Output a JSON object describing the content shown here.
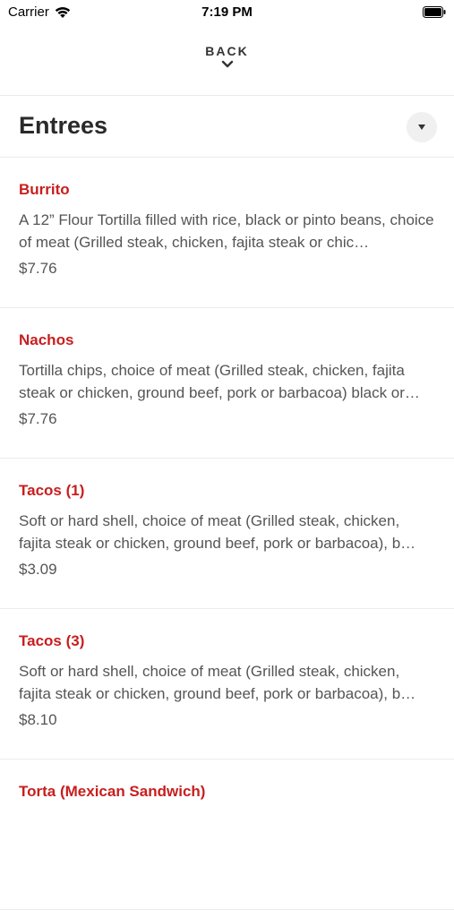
{
  "status_bar": {
    "carrier": "Carrier",
    "time": "7:19 PM"
  },
  "nav": {
    "back_label": "BACK"
  },
  "section": {
    "title": "Entrees"
  },
  "colors": {
    "item_name": "#c81e1e",
    "text_secondary": "#555555",
    "dropdown_bg": "#f0f0f0"
  },
  "menu_items": [
    {
      "name": "Burrito",
      "description": "A 12” Flour Tortilla filled with rice, black or pinto beans, choice of meat (Grilled steak, chicken, fajita steak or chic…",
      "price": "$7.76"
    },
    {
      "name": "Nachos",
      "description": "Tortilla chips, choice of meat (Grilled steak, chicken, fajita steak or chicken, ground beef, pork or barbacoa) black or…",
      "price": "$7.76"
    },
    {
      "name": "Tacos (1)",
      "description": "Soft or hard shell, choice of meat (Grilled steak, chicken, fajita steak or chicken, ground beef, pork or barbacoa), b…",
      "price": "$3.09"
    },
    {
      "name": "Tacos (3)",
      "description": "Soft or hard shell, choice of meat (Grilled steak, chicken, fajita steak or chicken, ground beef, pork or barbacoa), b…",
      "price": "$8.10"
    },
    {
      "name": "Torta (Mexican Sandwich)",
      "description": "",
      "price": ""
    }
  ]
}
